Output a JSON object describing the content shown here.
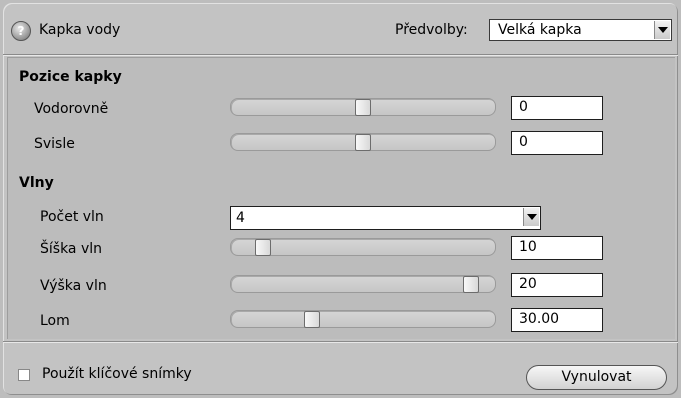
{
  "header": {
    "title": "Kapka vody",
    "presets_label": "Předvolby:",
    "presets_value": "Velká kapka",
    "help_glyph": "?"
  },
  "sections": {
    "position_title": "Pozice kapky",
    "waves_title": "Vlny"
  },
  "rows": {
    "horizontal": {
      "label": "Vodorovně",
      "value": "0",
      "slider_fraction": 0.5
    },
    "vertical": {
      "label": "Svisle",
      "value": "0",
      "slider_fraction": 0.5
    },
    "wave_count": {
      "label": "Počet vln",
      "value": "4"
    },
    "wave_width": {
      "label": "Šíška vln",
      "value": "10",
      "slider_fraction": 0.1
    },
    "wave_height": {
      "label": "Výška vln",
      "value": "20",
      "slider_fraction": 0.95
    },
    "refraction": {
      "label": "Lom",
      "value": "30.00",
      "slider_fraction": 0.3
    }
  },
  "footer": {
    "keyframes_label": "Použít klíčové snímky",
    "keyframes_checked": false,
    "reset_label": "Vynulovat"
  }
}
